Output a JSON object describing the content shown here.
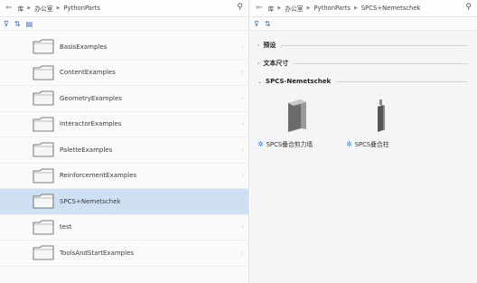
{
  "left": {
    "breadcrumb": [
      "库",
      "办公室",
      "PythonParts"
    ],
    "folders": [
      {
        "label": "BasisExamples",
        "selected": false
      },
      {
        "label": "ContentExamples",
        "selected": false
      },
      {
        "label": "GeometryExamples",
        "selected": false
      },
      {
        "label": "InteractorExamples",
        "selected": false
      },
      {
        "label": "PaletteExamples",
        "selected": false
      },
      {
        "label": "ReinforcementExamples",
        "selected": false
      },
      {
        "label": "SPCS+Nemetschek",
        "selected": true
      },
      {
        "label": "test",
        "selected": false
      },
      {
        "label": "ToolsAndStartExamples",
        "selected": false
      }
    ]
  },
  "right": {
    "breadcrumb": [
      "库",
      "办公室",
      "PythonParts",
      "SPCS+Nemetschek"
    ],
    "sections": [
      {
        "title": "预设",
        "expanded": false
      },
      {
        "title": "文本尺寸",
        "expanded": false
      },
      {
        "title": "SPCS-Nemetschek",
        "expanded": true
      }
    ],
    "items": [
      {
        "label": "SPCS叠合剪力墙",
        "icon": "pythonpart-icon"
      },
      {
        "label": "SPCS叠合柱",
        "icon": "pythonpart-icon"
      }
    ]
  }
}
